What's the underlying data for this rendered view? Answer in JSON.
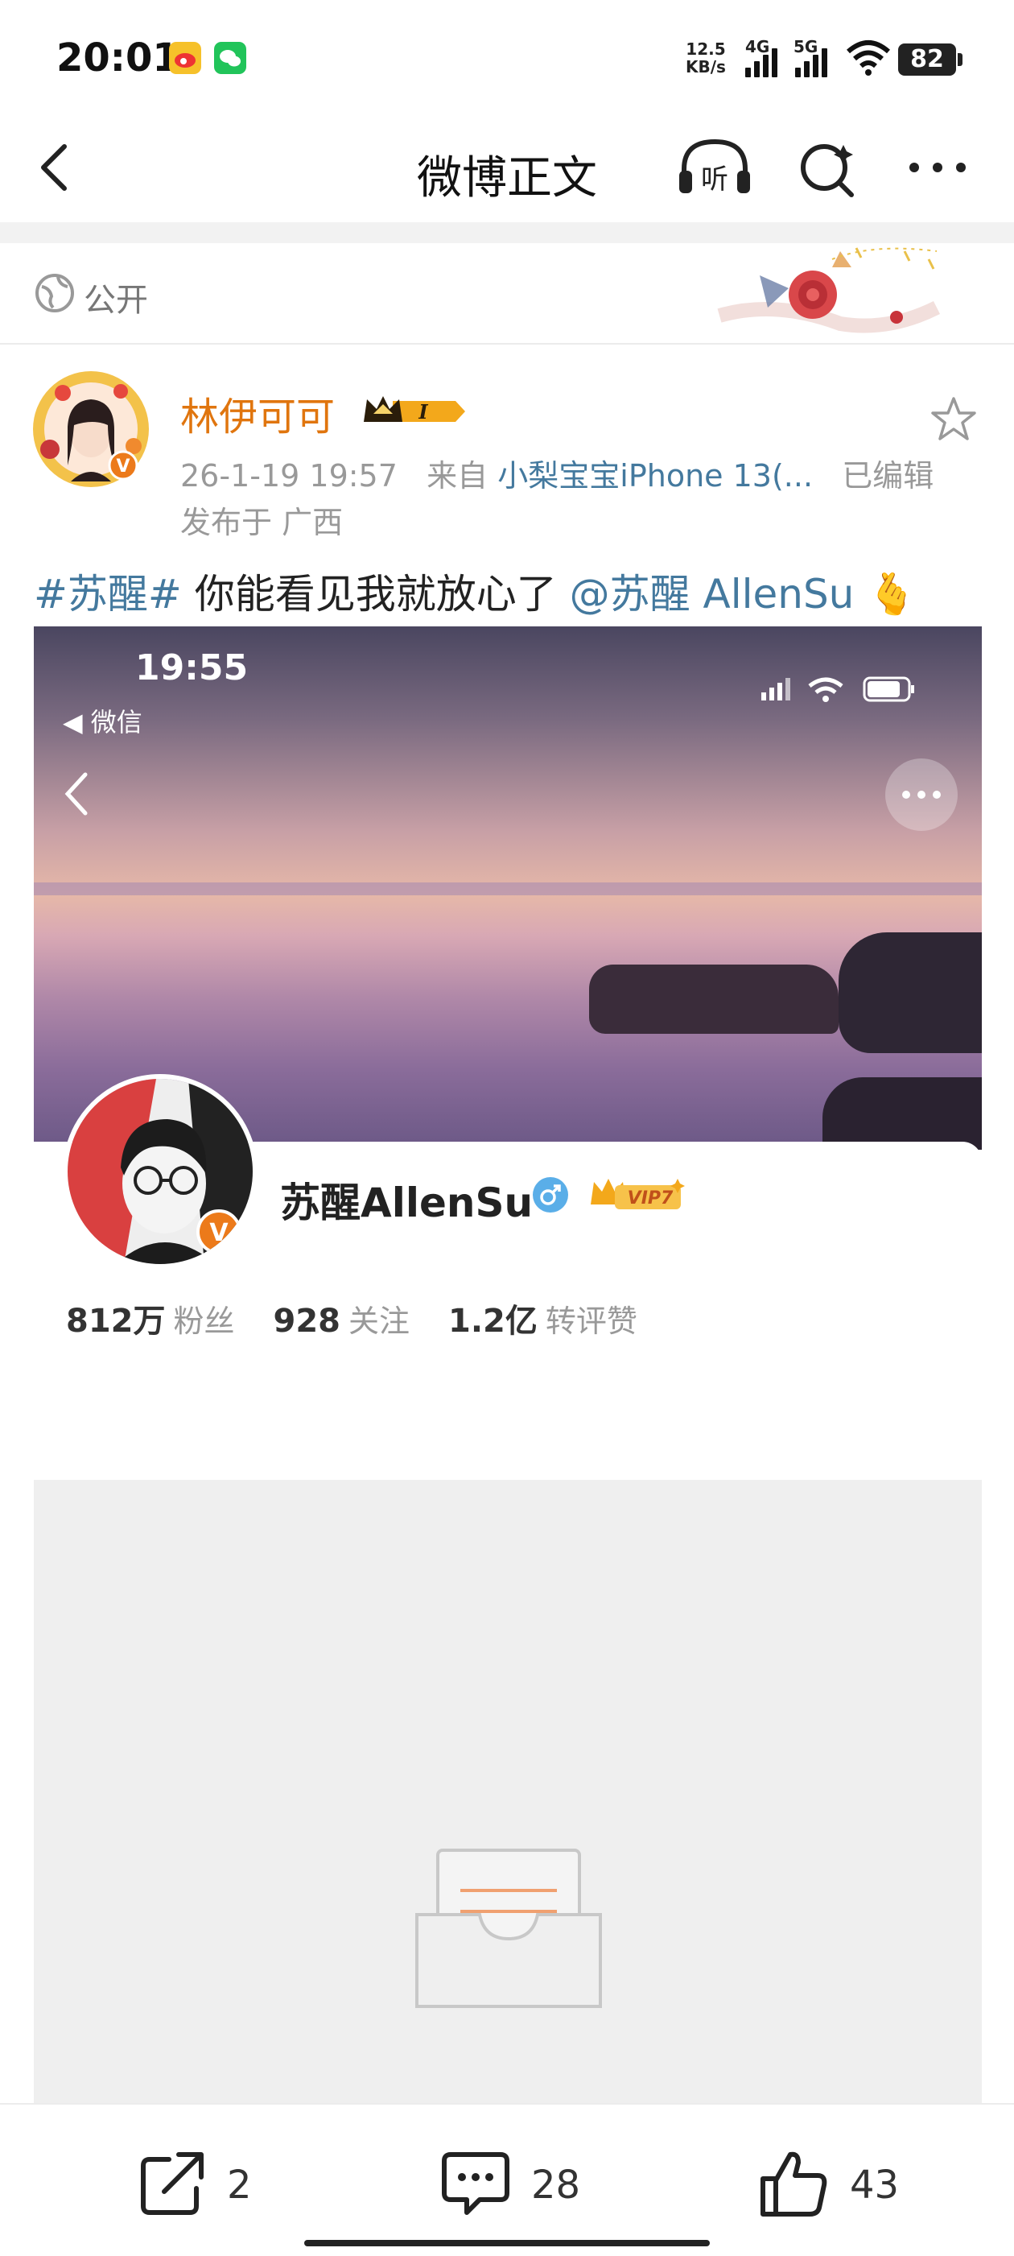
{
  "status_bar": {
    "time": "20:01",
    "net_speed_value": "12.5",
    "net_speed_unit": "KB/s",
    "signal1": "4G",
    "signal2": "5G",
    "battery": "82",
    "icons": [
      "weibo-app-icon",
      "wechat-app-icon",
      "wifi-icon",
      "battery-icon"
    ]
  },
  "nav": {
    "title": "微博正文",
    "icons": [
      "back-icon",
      "listen-icon",
      "search-icon",
      "more-icon"
    ],
    "listen_label": "听"
  },
  "visibility": {
    "label": "公开",
    "icon": "globe-icon"
  },
  "post": {
    "author": "林伊可可",
    "date": "26-1-19 19:57",
    "from_label": "来自",
    "source": "小梨宝宝iPhone 13(...",
    "edited": "已编辑",
    "location": "发布于 广西",
    "hashtag": "#苏醒#",
    "text": "你能看见我就放心了",
    "mention": "@苏醒 AllenSu",
    "emoji": "🫰"
  },
  "embedded": {
    "time": "19:55",
    "back_app": "◀ 微信",
    "profile_name": "苏醒AllenSu",
    "vip_label": "VIP7",
    "stats": [
      {
        "value": "812万",
        "label": "粉丝"
      },
      {
        "value": "928",
        "label": "关注"
      },
      {
        "value": "1.2亿",
        "label": "转评赞"
      }
    ]
  },
  "actions": {
    "repost_count": "2",
    "comment_count": "28",
    "like_count": "43"
  },
  "colors": {
    "link": "#44799e",
    "author": "#e0750e",
    "accent_vip": "#f3a81b"
  }
}
